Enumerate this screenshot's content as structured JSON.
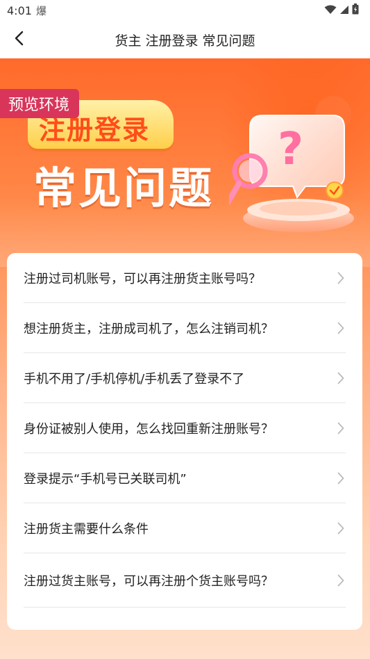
{
  "status_bar": {
    "time": "4:01",
    "notification_glyph": "爆"
  },
  "nav": {
    "title": "货主 注册登录 常见问题"
  },
  "banner": {
    "env_tag": "预览环境",
    "title_line1": "注册登录",
    "title_line2": "常见问题"
  },
  "faq": {
    "items": [
      {
        "label": "注册过司机账号，可以再注册货主账号吗？"
      },
      {
        "label": "想注册货主，注册成司机了，怎么注销司机？"
      },
      {
        "label": "手机不用了/手机停机/手机丢了登录不了"
      },
      {
        "label": "身份证被别人使用，怎么找回重新注册账号？"
      },
      {
        "label": "登录提示“手机号已关联司机”"
      },
      {
        "label": "注册货主需要什么条件"
      },
      {
        "label": "注册过货主账号，可以再注册个货主账号吗？"
      }
    ]
  },
  "colors": {
    "accent": "#ff5a1f",
    "env_tag": "#d9355a",
    "title_yellow": "#ffcf4a"
  }
}
